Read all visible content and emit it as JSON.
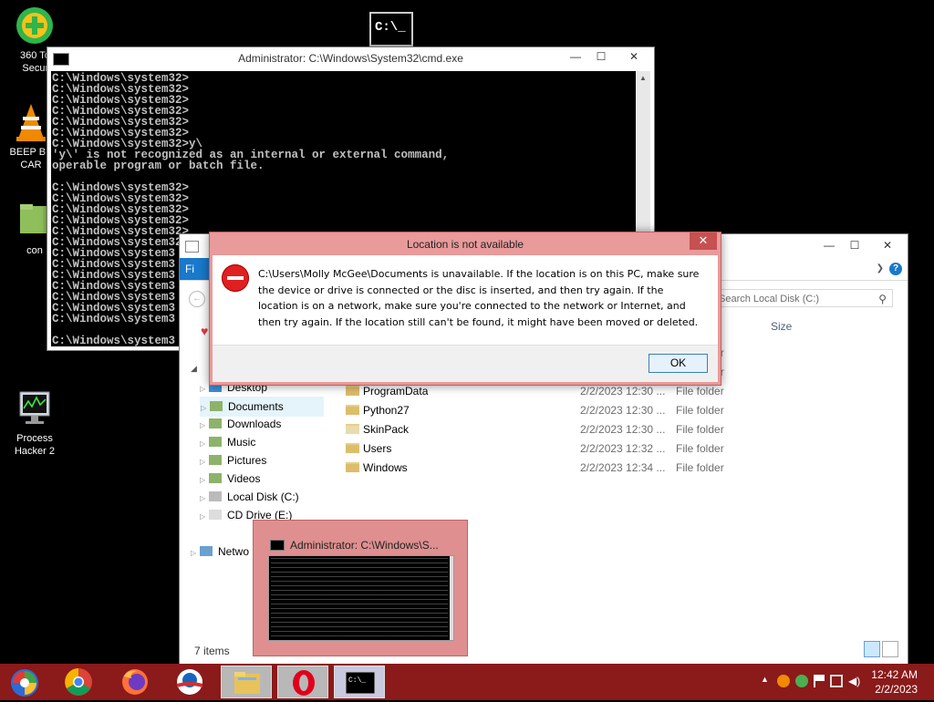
{
  "desktop": {
    "icons": [
      {
        "label": "360 Total Security",
        "short": "360 Tot\nSecuri"
      },
      {
        "label": "BEEP BEEP CAR",
        "short": "BEEP BE\nCAR"
      },
      {
        "label": "con",
        "short": "con"
      },
      {
        "label": "Process Hacker 2",
        "short": "Process\nHacker 2"
      }
    ]
  },
  "cmd": {
    "title": "Administrator: C:\\Windows\\System32\\cmd.exe",
    "lines": [
      "C:\\Windows\\system32>",
      "C:\\Windows\\system32>",
      "C:\\Windows\\system32>",
      "C:\\Windows\\system32>",
      "C:\\Windows\\system32>",
      "C:\\Windows\\system32>",
      "C:\\Windows\\system32>y\\",
      "'y\\' is not recognized as an internal or external command,",
      "operable program or batch file.",
      "",
      "C:\\Windows\\system32>",
      "C:\\Windows\\system32>",
      "C:\\Windows\\system32>",
      "C:\\Windows\\system32>",
      "C:\\Windows\\system32>",
      "C:\\Windows\\system32>",
      "C:\\Windows\\system3",
      "C:\\Windows\\system3",
      "C:\\Windows\\system3",
      "C:\\Windows\\system3",
      "C:\\Windows\\system3",
      "C:\\Windows\\system3",
      "C:\\Windows\\system3",
      "",
      "C:\\Windows\\system3"
    ]
  },
  "explorer": {
    "ribbon_file": "Fi",
    "search_placeholder": "Search Local Disk (C:)",
    "column_size": "Size",
    "nav": [
      {
        "label": "Desktop",
        "icon": "desktop-icon"
      },
      {
        "label": "Documents",
        "icon": "documents-icon",
        "selected": true
      },
      {
        "label": "Downloads",
        "icon": "downloads-icon"
      },
      {
        "label": "Music",
        "icon": "music-icon"
      },
      {
        "label": "Pictures",
        "icon": "pictures-icon"
      },
      {
        "label": "Videos",
        "icon": "videos-icon"
      },
      {
        "label": "Local Disk (C:)",
        "icon": "drive-icon"
      },
      {
        "label": "CD Drive (E:)",
        "icon": "cd-icon"
      },
      {
        "label": "Netwo",
        "icon": "network-icon"
      }
    ],
    "files": [
      {
        "name": "",
        "date": "",
        "type": "File folder"
      },
      {
        "name": "",
        "date": "",
        "type": "File folder"
      },
      {
        "name": "ProgramData",
        "date": "2/2/2023 12:30 ...",
        "type": "File folder"
      },
      {
        "name": "Python27",
        "date": "2/2/2023 12:30 ...",
        "type": "File folder"
      },
      {
        "name": "SkinPack",
        "date": "2/2/2023 12:30 ...",
        "type": "File folder"
      },
      {
        "name": "Users",
        "date": "2/2/2023 12:32 ...",
        "type": "File folder"
      },
      {
        "name": "Windows",
        "date": "2/2/2023 12:34 ...",
        "type": "File folder"
      }
    ],
    "status": "7 items"
  },
  "dialog": {
    "title": "Location is not available",
    "message": "C:\\Users\\Molly McGee\\Documents is unavailable. If the location is on this PC, make sure the device or drive is connected or the disc is inserted, and then try again. If the location is on a network, make sure you're connected to the network or Internet, and then try again. If the location still can't be found, it might have been moved or deleted.",
    "ok_label": "OK",
    "close_glyph": "✕"
  },
  "thumbnail": {
    "title": "Administrator: C:\\Windows\\S..."
  },
  "taskbar": {
    "apps": [
      "start-icon",
      "chrome-icon",
      "firefox-icon",
      "obama-icon",
      "file-explorer-icon",
      "opera-icon",
      "cmd-icon"
    ],
    "clock_time": "12:42 AM",
    "clock_date": "2/2/2023"
  },
  "colors": {
    "taskbar": "#8b1a1a",
    "dialog_frame": "#e99a9a",
    "accent": "#1979ca"
  }
}
